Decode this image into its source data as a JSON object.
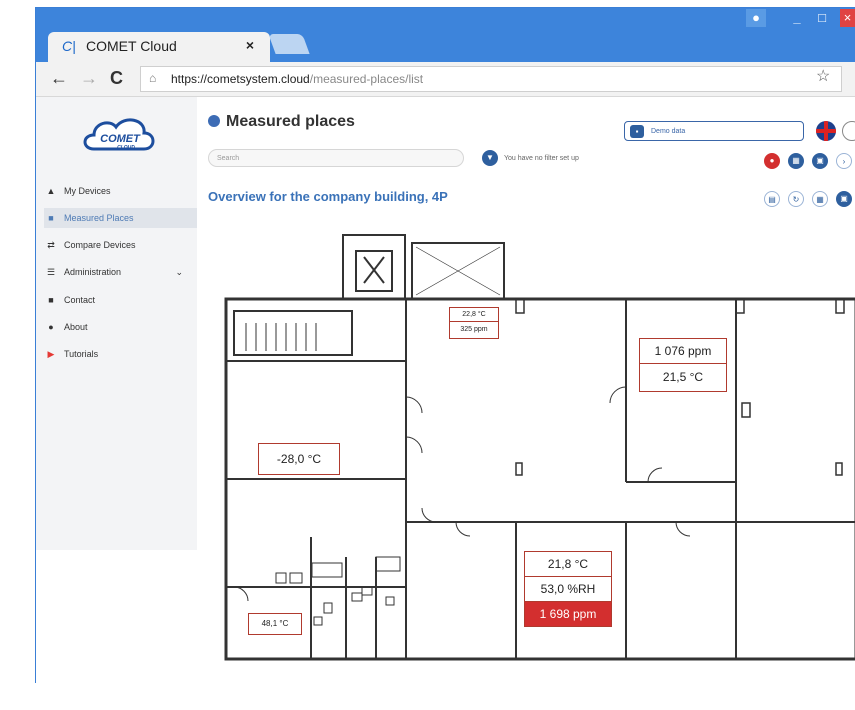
{
  "browser": {
    "tab_title": "COMET Cloud",
    "tab_logo": "C|",
    "tab_close": "×",
    "url_domain": "https://cometsystem.cloud",
    "url_path": "/measured-places/list"
  },
  "app": {
    "logo_text": "COMET",
    "logo_sub": "CLOUD",
    "page_title": "Measured places",
    "search_placeholder": "Search",
    "filter_text": "You have no filter set up",
    "demo_label": "Demo data",
    "overview_title": "Overview for the company building, 4P"
  },
  "sidebar": {
    "items": [
      {
        "label": "My Devices",
        "icon": "home-icon"
      },
      {
        "label": "Measured Places",
        "icon": "places-icon"
      },
      {
        "label": "Compare Devices",
        "icon": "compare-icon"
      },
      {
        "label": "Administration",
        "icon": "admin-icon"
      },
      {
        "label": "Contact",
        "icon": "contact-icon"
      },
      {
        "label": "About",
        "icon": "info-icon"
      },
      {
        "label": "Tutorials",
        "icon": "youtube-icon"
      }
    ]
  },
  "sensors": {
    "s1_temp": "22,8 °C",
    "s1_co2": "325 ppm",
    "s2_co2": "1 076 ppm",
    "s2_temp": "21,5 °C",
    "s3_temp": "-28,0 °C",
    "s4_temp": "21,8 °C",
    "s4_rh": "53,0 %RH",
    "s4_co2": "1 698 ppm",
    "s5_temp": "48,1 °C"
  },
  "colors": {
    "accent": "#3a72b8",
    "alarm": "#d32f2f",
    "frame": "#3a7fd6"
  }
}
